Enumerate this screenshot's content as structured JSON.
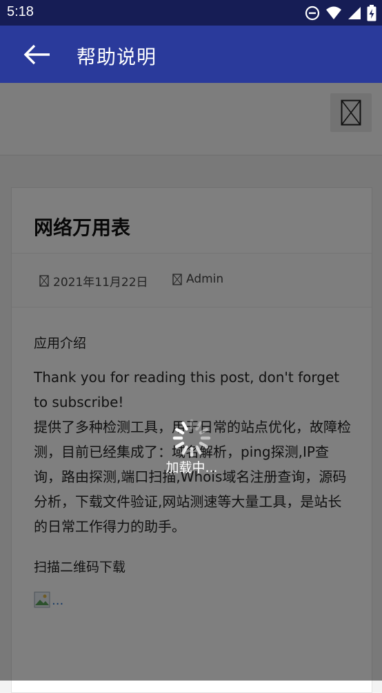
{
  "status_bar": {
    "time": "5:18"
  },
  "app_bar": {
    "title": "帮助说明"
  },
  "post": {
    "title": "网络万用表",
    "date": "2021年11月22日",
    "author": "Admin",
    "section_intro": "应用介绍",
    "body_line1": "Thank you for reading this post, don't forget to subscribe!",
    "body_line2": "提供了多种检测工具，用于日常的站点优化，故障检测，目前已经集成了：域名解析，ping探测,IP查询，路由探测,端口扫描,Whois域名注册查询，源码分析，下载文件验证,网站测速等大量工具，是站长的日常工作得力的助手。",
    "section_qr": "扫描二维码下载",
    "qr_alt": "..."
  },
  "loading": {
    "text": "加载中..."
  },
  "colors": {
    "status_bar": "#161d55",
    "app_bar": "#2a3a9b",
    "link": "#2a72c8"
  }
}
